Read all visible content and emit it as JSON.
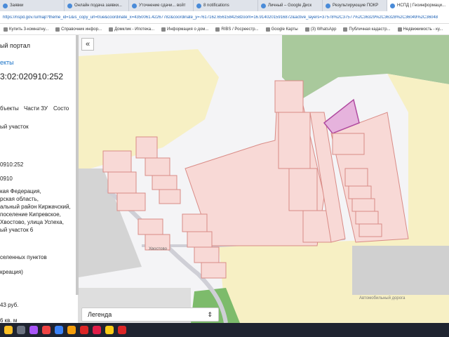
{
  "tabs": [
    {
      "label": "Заявки"
    },
    {
      "label": "Онлайн подача заявки..."
    },
    {
      "label": "Уточнение сдачи... войт"
    },
    {
      "label": "8 notifications"
    },
    {
      "label": "Личный – Google Диск"
    },
    {
      "label": "Результирующие ПОКР"
    },
    {
      "label": "НСПД | Геоинформаци..."
    }
  ],
  "address": "https://nspd.gov.ru/map?theme_id=1&is_copy_url=true&coordinate_x=4350061.42267782&coordinate_y=7617162.6561584258zoom=16.91402015916872&active_layers=37578%2C37577%2C36329%2C36328%2C36049%2C36048",
  "bookmarks": [
    "Купить 3-комнатну...",
    "Справочник инфор...",
    "Домклик - Ипотека...",
    "Информация о дом...",
    "RIBS / Росреестр...",
    "Google Карты",
    "(3) WhatsApp",
    "Публичная кадастр...",
    "Недвижимость - ку..."
  ],
  "sidebar": {
    "portal": "ый портал",
    "objects_link": "екты",
    "cadastral_number": "3:02:020910:252",
    "tabs": [
      "бъекты",
      "Части ЗУ",
      "Состо"
    ],
    "type": "ый участок",
    "num_short": "0910:252",
    "quarter": "0910",
    "addr_lines": [
      "кая Федерация,",
      "рская область,",
      "альный район Киржачский,",
      "поселение Кипревское,",
      "Хвостово, улица Успеха,",
      "ый участок 6"
    ],
    "category": "селенных пунктов",
    "usage": "креация)",
    "cost": "43 руб.",
    "area": "6 кв. м"
  },
  "map": {
    "village_label": "Хвостово",
    "attribution": "Автомобильный дорога"
  },
  "legend": {
    "label": "Легенда"
  }
}
